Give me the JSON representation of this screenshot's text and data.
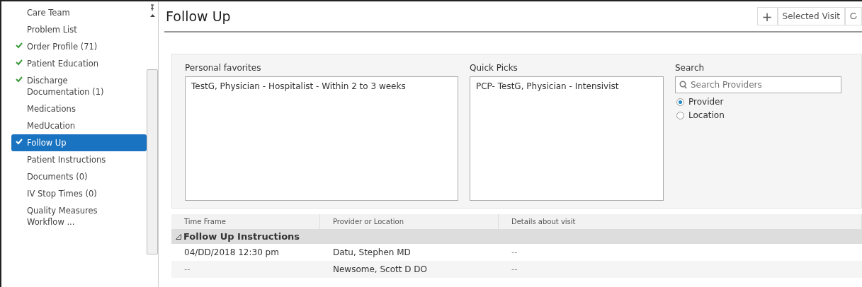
{
  "sidebar": {
    "items": [
      {
        "label": "Care Team",
        "checked": false,
        "selected": false
      },
      {
        "label": "Problem List",
        "checked": false,
        "selected": false
      },
      {
        "label": "Order Profile (71)",
        "checked": true,
        "selected": false
      },
      {
        "label": "Patient Education",
        "checked": true,
        "selected": false
      },
      {
        "label": "Discharge Documentation (1)",
        "checked": true,
        "selected": false
      },
      {
        "label": "Medications",
        "checked": false,
        "selected": false
      },
      {
        "label": "MedUcation",
        "checked": false,
        "selected": false
      },
      {
        "label": "Follow Up",
        "checked": true,
        "selected": true
      },
      {
        "label": "Patient Instructions",
        "checked": false,
        "selected": false
      },
      {
        "label": "Documents (0)",
        "checked": false,
        "selected": false
      },
      {
        "label": "IV Stop Times (0)",
        "checked": false,
        "selected": false
      },
      {
        "label": "Quality Measures Workflow ...",
        "checked": false,
        "selected": false
      }
    ]
  },
  "header": {
    "title": "Follow Up",
    "add": "+",
    "visit": "Selected Visit"
  },
  "favorites": {
    "label": "Personal favorites",
    "items": [
      "TestG, Physician - Hospitalist - Within 2 to 3 weeks"
    ]
  },
  "quick_picks": {
    "label": "Quick Picks",
    "items": [
      "PCP- TestG, Physician - Intensivist"
    ]
  },
  "search": {
    "label": "Search",
    "placeholder": "Search Providers",
    "options": [
      {
        "label": "Provider",
        "selected": true
      },
      {
        "label": "Location",
        "selected": false
      }
    ]
  },
  "table": {
    "columns": [
      "Time Frame",
      "Provider or Location",
      "Details about visit"
    ],
    "group": "Follow Up Instructions",
    "rows": [
      {
        "cells": [
          "04/DD/2018 12:30 pm",
          "Datu, Stephen MD",
          "--"
        ]
      },
      {
        "cells": [
          "--",
          "Newsome, Scott D DO",
          "--"
        ]
      }
    ]
  }
}
